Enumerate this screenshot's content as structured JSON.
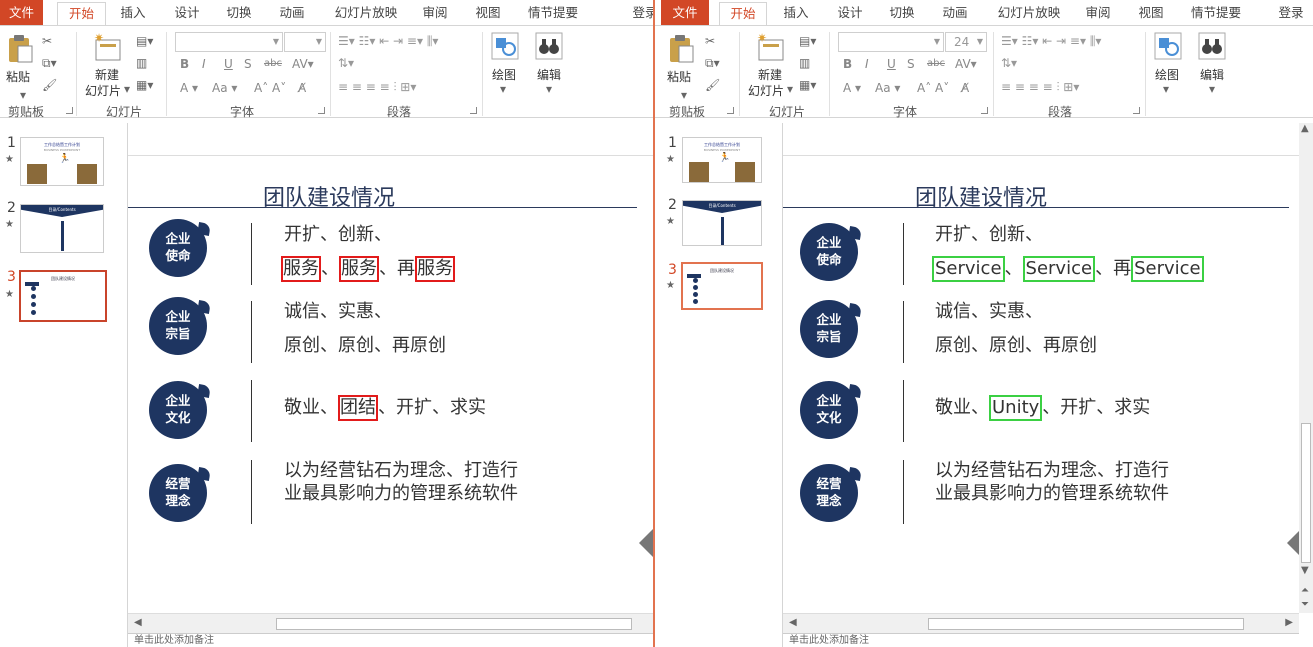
{
  "ribbon": {
    "tabs": [
      "文件",
      "开始",
      "插入",
      "设计",
      "切换",
      "动画",
      "幻灯片放映",
      "审阅",
      "视图",
      "情节提要",
      "登录"
    ],
    "active_tab": "开始",
    "paste_label": "粘贴",
    "new_slide_label_1": "新建",
    "new_slide_label_2": "幻灯片",
    "draw_label": "绘图",
    "edit_label": "编辑",
    "groups": {
      "clipboard": "剪贴板",
      "slides": "幻灯片",
      "font": "字体",
      "paragraph": "段落"
    }
  },
  "font_size_value_right": "24",
  "thumbnails": [
    {
      "num": "1",
      "title": "工作总结暨工作计划",
      "subtitle": "BUSINESS POWERPOINT"
    },
    {
      "num": "2",
      "title": "目录/Contents"
    },
    {
      "num": "3",
      "title": "团队建设情况"
    }
  ],
  "slide": {
    "title": "团队建设情况",
    "circles": [
      {
        "l1": "企业",
        "l2": "使命"
      },
      {
        "l1": "企业",
        "l2": "宗旨"
      },
      {
        "l1": "企业",
        "l2": "文化"
      },
      {
        "l1": "经营",
        "l2": "理念"
      }
    ],
    "mission_line1": "开扩、创新、",
    "purpose_line1": "诚信、实惠、",
    "purpose_line2": "原创、原创、再原创",
    "culture_prefix": "敬业、",
    "culture_suffix": "、开扩、求实",
    "philosophy_line1": "以为经营钻石为理念、打造行",
    "philosophy_line2": "业最具影响力的管理系统软件",
    "sep": "、",
    "re": "再"
  },
  "left": {
    "service": "服务",
    "unity": "团结"
  },
  "right": {
    "service": "Service",
    "unity": "Unity"
  },
  "notes_placeholder": "单击此处添加备注"
}
